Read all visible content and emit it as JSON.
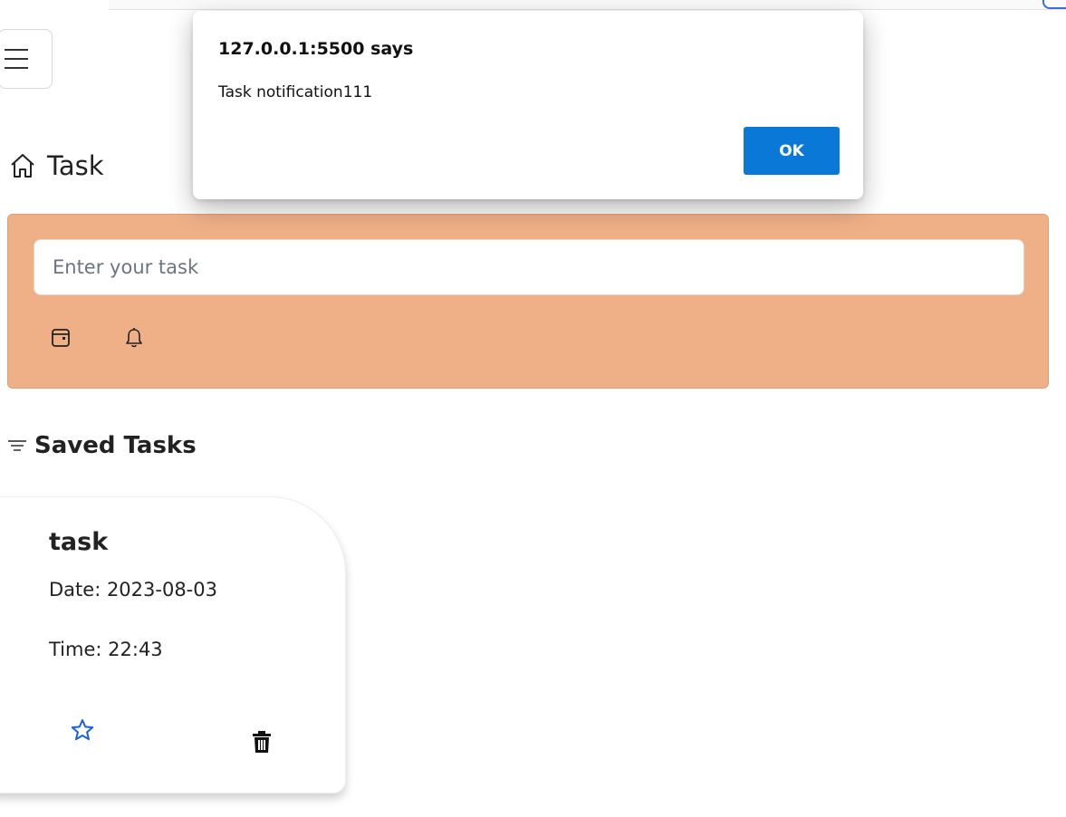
{
  "dialog": {
    "origin": "127.0.0.1:5500 says",
    "message": "Task notification111",
    "ok_label": "OK"
  },
  "header": {
    "menu_icon": "hamburger-menu-icon",
    "home_icon": "house-icon",
    "title": "Task"
  },
  "task_form": {
    "input_placeholder": "Enter your task",
    "input_value": "",
    "date_icon": "calendar-icon",
    "notify_icon": "bell-icon"
  },
  "saved_tasks": {
    "heading_icon": "list-filter-icon",
    "heading": "Saved Tasks",
    "items": [
      {
        "title": "task",
        "date": "Date: 2023-08-03",
        "time": "Time: 22:43",
        "favorite_icon": "star-icon",
        "delete_icon": "trash-icon"
      }
    ]
  },
  "colors": {
    "panel_background": "#efb087",
    "ok_button": "#0a78d7",
    "star": "#1a5fd8"
  }
}
